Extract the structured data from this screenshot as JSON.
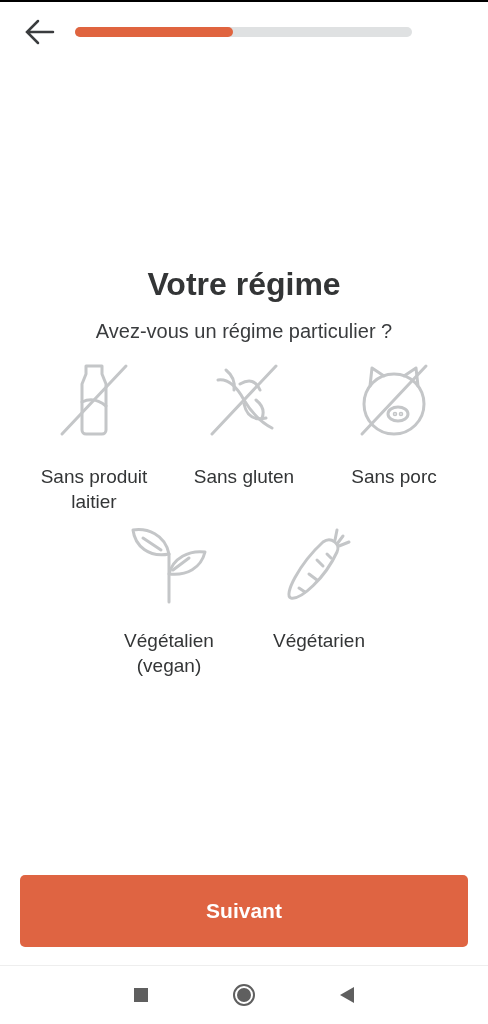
{
  "progress": {
    "level": 0.47
  },
  "title": "Votre régime",
  "subtitle": "Avez-vous un régime particulier ?",
  "options": [
    {
      "kind": "dairy",
      "label": "Sans produit laitier",
      "selected": false
    },
    {
      "kind": "gluten",
      "label": "Sans gluten",
      "selected": false
    },
    {
      "kind": "pork",
      "label": "Sans porc",
      "selected": false
    },
    {
      "kind": "vegan",
      "label": "Végétalien (vegan)",
      "selected": false
    },
    {
      "kind": "vegetarian",
      "label": "Végétarien",
      "selected": false
    }
  ],
  "next_button": "Suivant"
}
